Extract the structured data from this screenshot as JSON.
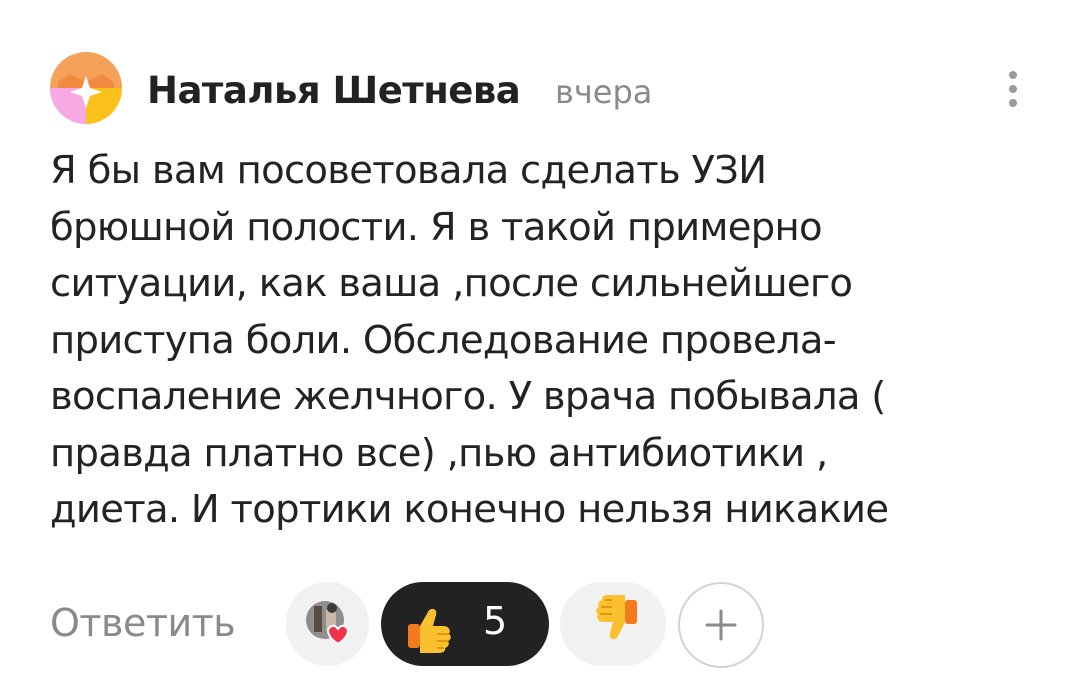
{
  "comment": {
    "author": "Наталья Шетнева",
    "time": "вчера",
    "lines": [
      "Я бы вам посоветовала сделать УЗИ",
      "брюшной полости. Я в такой примерно",
      "ситуации, как ваша ,после сильнейшего",
      "приступа боли. Обследование провела-",
      "воспаление желчного. У врача побывала (",
      "правда платно все) ,пью антибиотики ,",
      "диета. И тортики конечно нельзя никакие"
    ]
  },
  "actions": {
    "reply_label": "Ответить",
    "like_count": "5"
  },
  "icons": {
    "menu": "vertical-dots-icon",
    "reactor_avatar": "reactor-avatar-heart-icon",
    "like": "thumbs-up-emoji-icon",
    "dislike": "thumbs-down-emoji-icon",
    "add": "plus-icon"
  },
  "colors": {
    "like_pill_bg": "#222222",
    "pill_bg": "#f1f1f1",
    "muted_text": "#8a8a8a"
  }
}
